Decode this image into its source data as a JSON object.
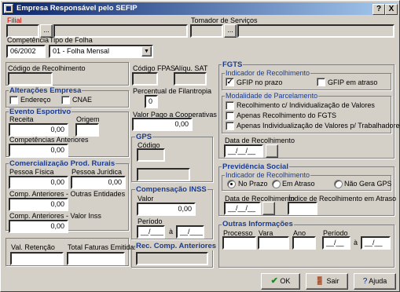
{
  "window": {
    "title": "Empresa Responsável pelo SEFIP",
    "help_btn": "?",
    "close_btn": "X"
  },
  "top": {
    "filial_label": "Filial",
    "tomador_label": "Tomador de Serviços",
    "competencia_label": "Competência",
    "competencia_value": "06/2002",
    "tipo_folha_label": "Tipo de Folha",
    "tipo_folha_value": "01 - Folha Mensal",
    "lookup_btn": "..."
  },
  "left": {
    "codigo_recolhimento_label": "Código de Recolhimento",
    "alteracoes_title": "Alterações Empresa",
    "endereco_label": "Endereço",
    "cnae_label": "CNAE",
    "evento_title": "Evento Esportivo",
    "receita_label": "Receita",
    "receita_value": "0,00",
    "origem_label": "Origem",
    "comp_anteriores_label": "Competências Anteriores",
    "comp_anteriores_value": "0,00",
    "comercializacao_title": "Comercialização Prod. Rurais",
    "pessoa_fisica_label": "Pessoa Física",
    "pessoa_fisica_value": "0,00",
    "pessoa_juridica_label": "Pessoa Jurídica",
    "pessoa_juridica_value": "0,00",
    "comp_outras_label": "Comp. Anteriores - Outras Entidades",
    "comp_outras_value": "0,00",
    "comp_inss_label": "Comp. Anteriores - Valor Inss",
    "comp_inss_value": "0,00",
    "val_retencao_label": "Val. Retenção",
    "total_faturas_label": "Total Faturas Emitidas"
  },
  "middle": {
    "codigo_fpas_label": "Código FPAS",
    "aliq_sat_label": "Alíqu. SAT",
    "percentual_label": "Percentual de Filantropia",
    "percentual_value": "0",
    "valor_pago_label": "Valor Pago a Cooperativas",
    "valor_pago_value": "0,00",
    "gps_title": "GPS",
    "codigo_label": "Código",
    "compensacao_title": "Compensação INSS",
    "valor_label": "Valor",
    "valor_value": "0,00",
    "periodo_label": "Período",
    "periodo_mask": "__/____",
    "a_label": "à",
    "rec_comp_title": "Rec. Comp. Anteriores"
  },
  "right": {
    "fgts_title": "FGTS",
    "indicador_title": "Indicador de Recolhimento",
    "gfip_prazo_label": "GFIP no prazo",
    "gfip_atraso_label": "GFIP em atraso",
    "modalidade_title": "Modalidade de Parcelamento",
    "mod1_label": "Recolhimento c/ Individualização de Valores",
    "mod2_label": "Apenas Recolhimento do FGTS",
    "mod3_label": "Apenas Individualização de Valores p/ Trabalhadores",
    "data_rec_label": "Data de Recolhimento",
    "date_mask": "__/__/__",
    "prev_title": "Previdência Social",
    "prev_indicador_title": "Indicador de Recolhimento",
    "no_prazo_label": "No Prazo",
    "em_atraso_label": "Em Atraso",
    "nao_gera_label": "Não Gera GPS",
    "indice_label": "Índice de Recolhimento em Atraso",
    "outras_title": "Outras Informações",
    "processo_label": "Processo",
    "vara_label": "Vara",
    "ano_label": "Ano",
    "periodo_label": "Período",
    "periodo_mask": "__/__",
    "a_label": "à"
  },
  "footer": {
    "ok_label": "OK",
    "sair_label": "Sair",
    "ajuda_label": "Ajuda"
  },
  "colors": {
    "group_title": "#1a3b8f",
    "required_label": "#c00000",
    "ok_icon": "#1a8a1a"
  }
}
